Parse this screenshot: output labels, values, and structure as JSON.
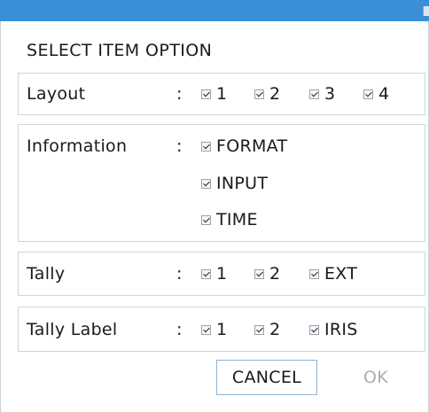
{
  "dialog": {
    "heading": "SELECT ITEM OPTION"
  },
  "groups": {
    "layout": {
      "label": "Layout",
      "colon": ":",
      "options": [
        {
          "label": "1",
          "checked": true
        },
        {
          "label": "2",
          "checked": true
        },
        {
          "label": "3",
          "checked": true
        },
        {
          "label": "4",
          "checked": true
        }
      ]
    },
    "information": {
      "label": "Information",
      "colon": ":",
      "options": [
        {
          "label": "FORMAT",
          "checked": true
        },
        {
          "label": "INPUT",
          "checked": true
        },
        {
          "label": "TIME",
          "checked": true
        }
      ]
    },
    "tally": {
      "label": "Tally",
      "colon": ":",
      "options": [
        {
          "label": "1",
          "checked": true
        },
        {
          "label": "2",
          "checked": true
        },
        {
          "label": "EXT",
          "checked": true
        }
      ]
    },
    "tally_label": {
      "label": "Tally Label",
      "colon": ":",
      "options": [
        {
          "label": "1",
          "checked": true
        },
        {
          "label": "2",
          "checked": true
        },
        {
          "label": "IRIS",
          "checked": true
        }
      ]
    }
  },
  "buttons": {
    "cancel_label": "CANCEL",
    "ok_label": "OK"
  },
  "colors": {
    "titlebar": "#3a8fd6",
    "border": "#cfd5db",
    "disabled_text": "#a8adb3"
  }
}
